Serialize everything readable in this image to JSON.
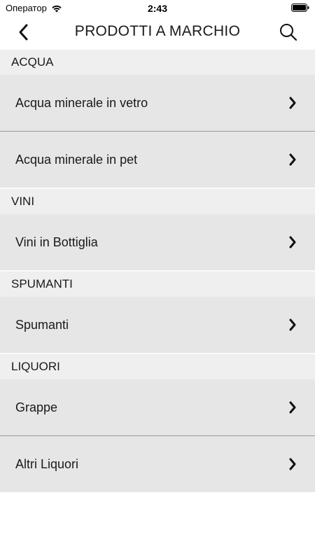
{
  "status_bar": {
    "carrier": "Оператор",
    "time": "2:43"
  },
  "nav": {
    "title": "PRODOTTI A MARCHIO"
  },
  "sections": [
    {
      "title": "ACQUA",
      "items": [
        "Acqua minerale in vetro",
        "Acqua minerale in pet"
      ]
    },
    {
      "title": "VINI",
      "items": [
        "Vini in Bottiglia"
      ]
    },
    {
      "title": "SPUMANTI",
      "items": [
        "Spumanti"
      ]
    },
    {
      "title": "LIQUORI",
      "items": [
        "Grappe",
        "Altri Liquori"
      ]
    }
  ]
}
